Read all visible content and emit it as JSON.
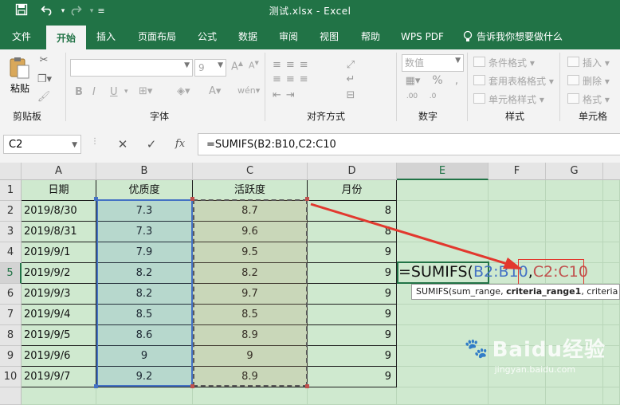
{
  "title": "测试.xlsx  -  Excel",
  "quick_access": {
    "save_icon": "save-icon",
    "undo_icon": "undo-icon",
    "redo_icon": "redo-icon",
    "customize_icon": "customize-icon"
  },
  "tabs": [
    "文件",
    "开始",
    "插入",
    "页面布局",
    "公式",
    "数据",
    "审阅",
    "视图",
    "帮助",
    "WPS PDF",
    "告诉我你想要做什么"
  ],
  "active_tab": "开始",
  "ribbon": {
    "paste_label": "粘贴",
    "clipboard_label": "剪贴板",
    "font_label": "字体",
    "font_size": "9",
    "font_name": "",
    "font_buttons": [
      "B",
      "I",
      "U"
    ],
    "alignment_label": "对齐方式",
    "number_label": "数字",
    "number_format": "数值",
    "styles_label": "样式",
    "conditional_format": "条件格式",
    "table_format": "套用表格格式",
    "cell_style": "单元格样式",
    "cells_label": "单元格",
    "insert": "插入",
    "delete": "删除",
    "format": "格式"
  },
  "name_box": "C2",
  "formula": "=SUMIFS(B2:B10,C2:C10",
  "columns": [
    "A",
    "B",
    "C",
    "D",
    "E",
    "F",
    "G"
  ],
  "rows": [
    "1",
    "2",
    "3",
    "4",
    "5",
    "6",
    "7",
    "8",
    "9",
    "10"
  ],
  "active_cell": "E5",
  "headers": [
    "日期",
    "优质度",
    "活跃度",
    "月份"
  ],
  "data": [
    [
      "2019/8/30",
      "7.3",
      "8.7",
      "8"
    ],
    [
      "2019/8/31",
      "7.3",
      "9.6",
      "8"
    ],
    [
      "2019/9/1",
      "7.9",
      "9.5",
      "9"
    ],
    [
      "2019/9/2",
      "8.2",
      "8.2",
      "9"
    ],
    [
      "2019/9/3",
      "8.2",
      "9.7",
      "9"
    ],
    [
      "2019/9/4",
      "8.5",
      "8.5",
      "9"
    ],
    [
      "2019/9/5",
      "8.6",
      "8.9",
      "9"
    ],
    [
      "2019/9/6",
      "9",
      "9",
      "9"
    ],
    [
      "2019/9/7",
      "9.2",
      "8.9",
      "9"
    ]
  ],
  "edit": {
    "prefix": "=SUMIFS(",
    "ref1": "B2:B10",
    "sep": ",",
    "ref2": "C2:C10"
  },
  "tooltip": {
    "fn": "SUMIFS(sum_range, ",
    "bold": "criteria_range1",
    "rest": ", criteria"
  },
  "colors": {
    "accent": "#217346",
    "ref1": "#4472c4",
    "ref2": "#c0504d",
    "fill": "#cfe9cf",
    "arrow": "#e2382e"
  },
  "watermark": {
    "brand": "Baidu经验",
    "url": "jingyan.baidu.com"
  }
}
